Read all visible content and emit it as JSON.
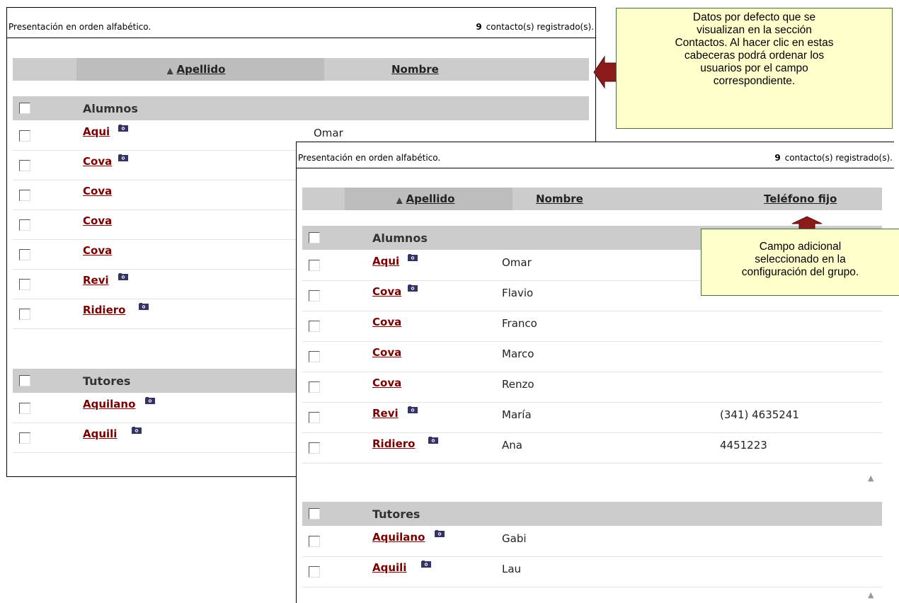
{
  "panel1": {
    "presentation": "Presentación en orden alfabético.",
    "count": "9",
    "count_suffix": "contacto(s) registrado(s).",
    "headers": {
      "apellido": "Apellido",
      "nombre": "Nombre"
    },
    "groups": [
      {
        "name": "Alumnos",
        "rows": [
          {
            "last": "Aqui",
            "first": "Omar",
            "photo": true
          },
          {
            "last": "Cova",
            "photo": true
          },
          {
            "last": "Cova",
            "photo": false
          },
          {
            "last": "Cova",
            "photo": false
          },
          {
            "last": "Cova",
            "photo": false
          },
          {
            "last": "Revi",
            "photo": true
          },
          {
            "last": "Ridiero",
            "photo": true
          }
        ]
      },
      {
        "name": "Tutores",
        "rows": [
          {
            "last": "Aquilano",
            "photo": true
          },
          {
            "last": "Aquili",
            "photo": true
          }
        ]
      }
    ]
  },
  "panel2": {
    "presentation": "Presentación en orden alfabético.",
    "count": "9",
    "count_suffix": "contacto(s) registrado(s).",
    "headers": {
      "apellido": "Apellido",
      "nombre": "Nombre",
      "telefono": "Teléfono fijo"
    },
    "groups": [
      {
        "name": "Alumnos",
        "rows": [
          {
            "last": "Aqui",
            "first": "Omar",
            "phone": "",
            "photo": true
          },
          {
            "last": "Cova",
            "first": "Flavio",
            "phone": "",
            "photo": true
          },
          {
            "last": "Cova",
            "first": "Franco",
            "phone": "",
            "photo": false
          },
          {
            "last": "Cova",
            "first": "Marco",
            "phone": "",
            "photo": false
          },
          {
            "last": "Cova",
            "first": "Renzo",
            "phone": "",
            "photo": false
          },
          {
            "last": "Revi",
            "first": "María",
            "phone": "(341) 4635241",
            "photo": true
          },
          {
            "last": "Ridiero",
            "first": "Ana",
            "phone": "4451223",
            "photo": true
          }
        ]
      },
      {
        "name": "Tutores",
        "rows": [
          {
            "last": "Aquilano",
            "first": "Gabi",
            "phone": "",
            "photo": true
          },
          {
            "last": "Aquili",
            "first": "Lau",
            "phone": "",
            "photo": true
          }
        ]
      }
    ]
  },
  "callout1": [
    "Datos por defecto que se",
    "visualizan en la sección",
    "Contactos. Al hacer clic en estas",
    "cabeceras podrá ordenar los",
    "usuarios por el campo",
    "correspondiente."
  ],
  "callout2": [
    "Campo adicional",
    "seleccionado en la",
    "configuración del grupo."
  ],
  "colors": {
    "link": "#7a0000",
    "header_bg": "#cccccc",
    "callout_bg": "#ffffcc",
    "arrow": "#8b1a1a"
  }
}
